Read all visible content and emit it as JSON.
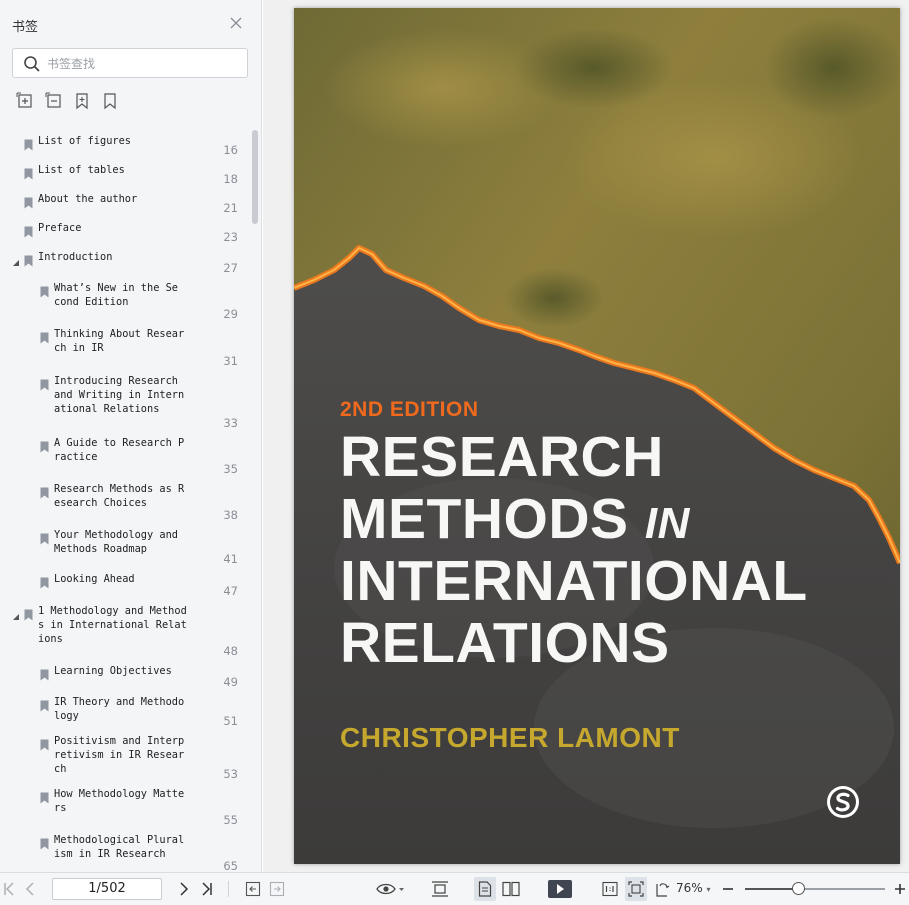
{
  "sidebar": {
    "title": "书签",
    "search_placeholder": "书签查找",
    "tools": [
      "expand-all-icon",
      "collapse-all-icon",
      "add-bookmark-icon",
      "bookmark-icon"
    ],
    "bookmarks": [
      {
        "label": "List of figures",
        "page": "16"
      },
      {
        "label": "List of tables",
        "page": "18"
      },
      {
        "label": "About the author",
        "page": "21"
      },
      {
        "label": "Preface",
        "page": "23"
      },
      {
        "label": "Introduction",
        "page": "27"
      },
      {
        "label": "What’s New in the Se\ncond Edition",
        "page": "29"
      },
      {
        "label": "Thinking About Resear\nch in IR",
        "page": "31"
      },
      {
        "label": "Introducing Research\nand Writing in Intern\national Relations",
        "page": "33"
      },
      {
        "label": "A Guide to Research P\nractice",
        "page": "35"
      },
      {
        "label": "Research Methods as R\nesearch Choices",
        "page": "38"
      },
      {
        "label": "Your Methodology and\nMethods Roadmap",
        "page": "41"
      },
      {
        "label": "Looking Ahead",
        "page": "47"
      },
      {
        "label": "1 Methodology and Method\ns in International Relat\nions",
        "page": "48"
      },
      {
        "label": "Learning Objectives",
        "page": "49"
      },
      {
        "label": "IR Theory and Methodo\nlogy",
        "page": "51"
      },
      {
        "label": "Positivism and Interp\nretivism in IR Resear\nch",
        "page": "53"
      },
      {
        "label": "How Methodology Matte\nrs",
        "page": "55"
      },
      {
        "label": "Methodological Plural\nism in IR Research",
        "page": "65"
      }
    ]
  },
  "cover": {
    "edition": "2ND EDITION",
    "title_lines": [
      "RESEARCH",
      "METHODS ",
      "INTERNATIONAL",
      "RELATIONS"
    ],
    "title_in": "IN",
    "author": "CHRISTOPHER LAMONT",
    "colors": {
      "edition": "#f06a1e",
      "author": "#c7a82e",
      "title": "#f7f7f5"
    }
  },
  "toolbar": {
    "page_indicator": "1/502",
    "zoom": "76%",
    "zoom_fraction": 0.38
  }
}
